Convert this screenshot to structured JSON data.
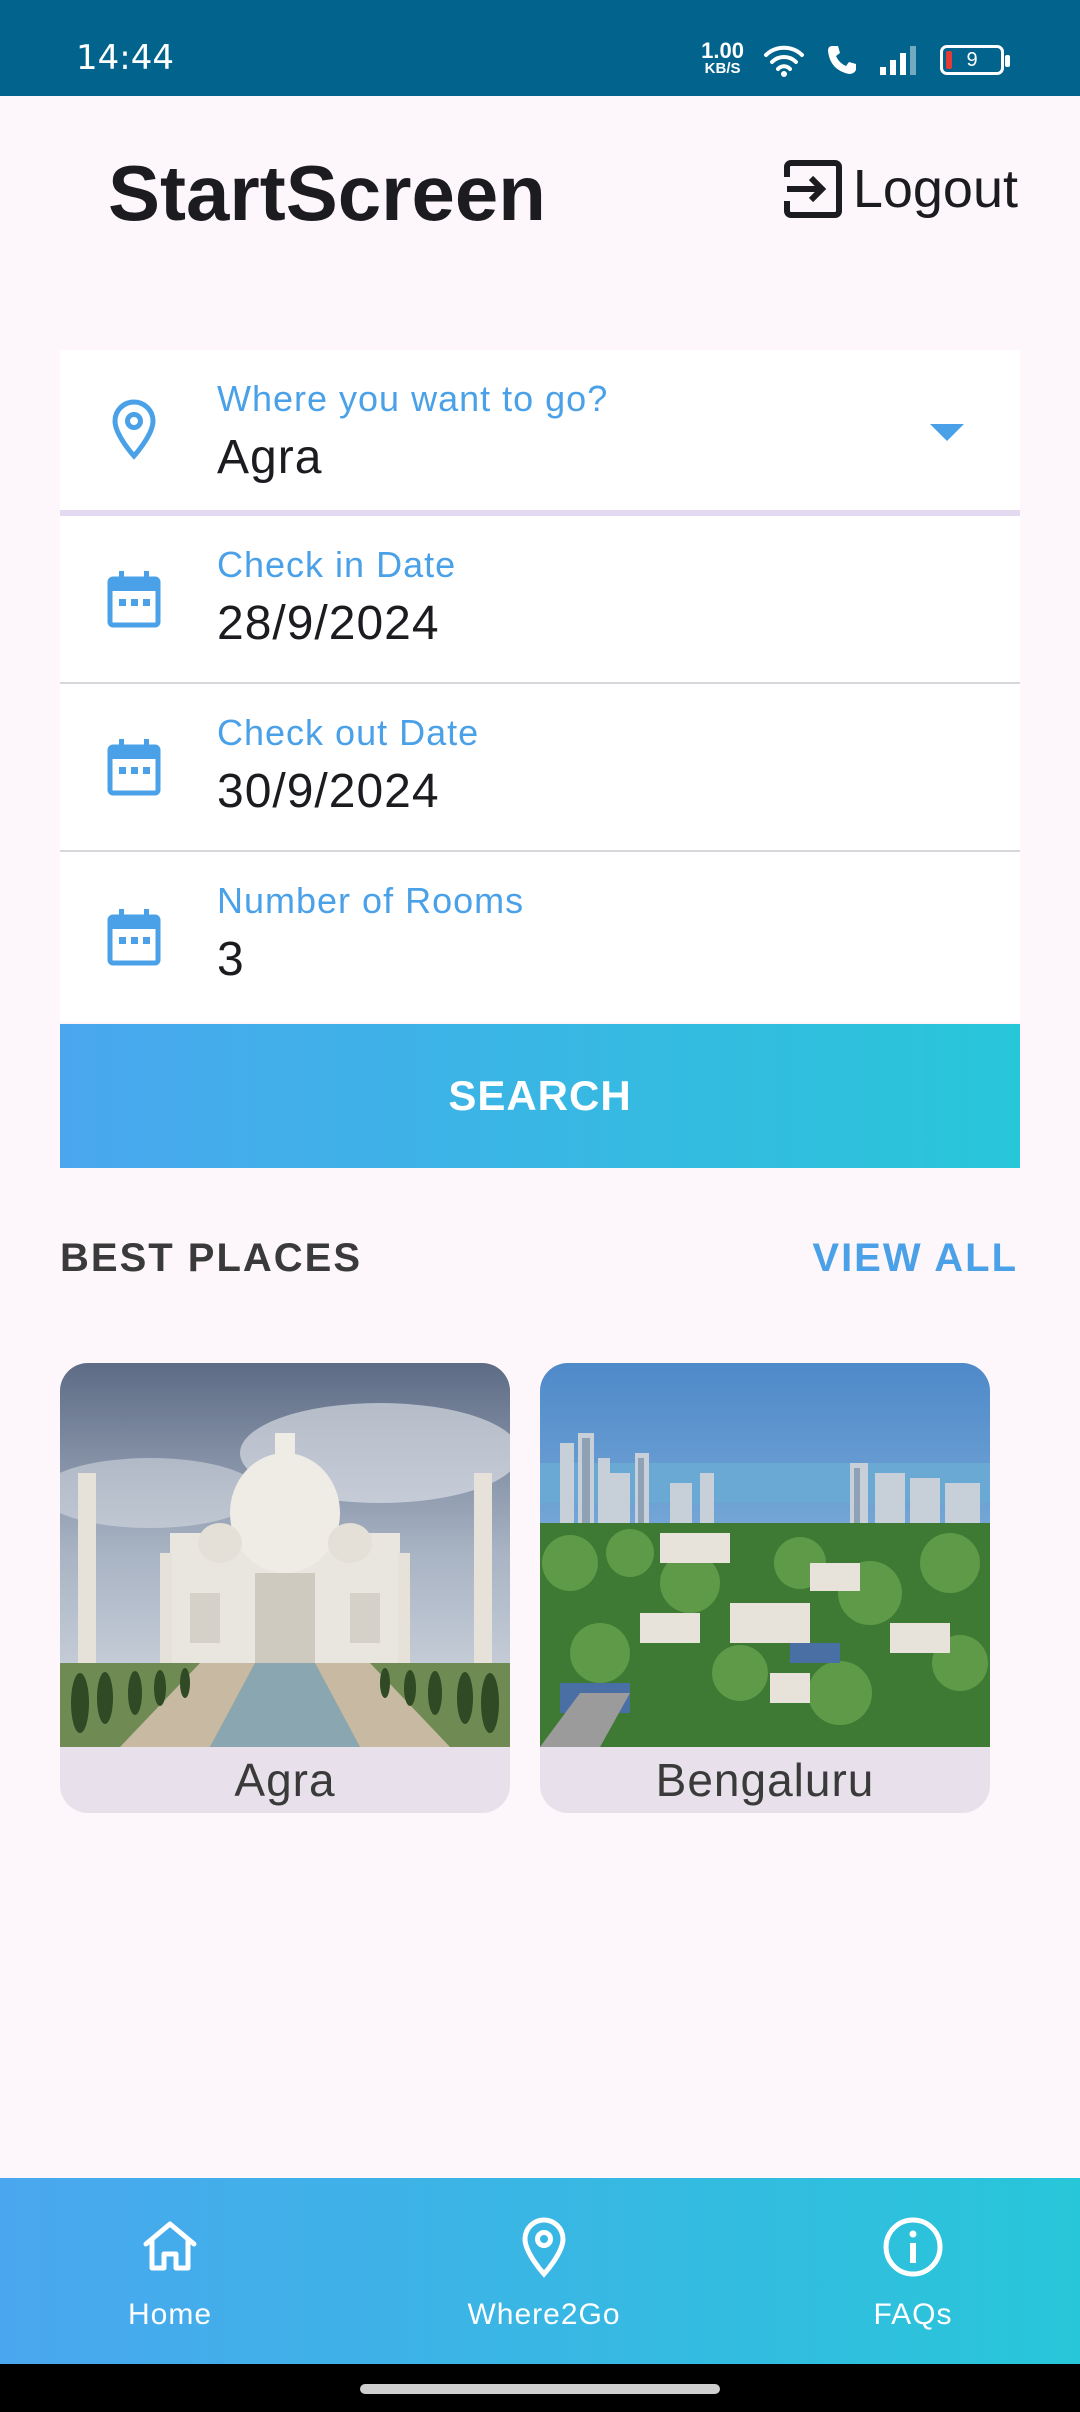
{
  "status_bar": {
    "time": "14:44",
    "net_speed": "1.00",
    "net_unit": "KB/S",
    "battery": "9"
  },
  "header": {
    "title": "StartScreen",
    "logout_label": "Logout",
    "logout_icon": "logout-icon"
  },
  "form": {
    "destination": {
      "label": "Where you want to go?",
      "value": "Agra",
      "icon": "location-pin-icon"
    },
    "check_in": {
      "label": "Check in Date",
      "value": "28/9/2024",
      "icon": "calendar-icon"
    },
    "check_out": {
      "label": "Check out Date",
      "value": "30/9/2024",
      "icon": "calendar-icon"
    },
    "rooms": {
      "label": "Number of Rooms",
      "value": "3",
      "icon": "calendar-icon"
    },
    "search_label": "SEARCH"
  },
  "best_places": {
    "title": "BEST PLACES",
    "view_all": "VIEW ALL",
    "items": [
      {
        "name": "Agra"
      },
      {
        "name": "Bengaluru"
      }
    ]
  },
  "bottom_nav": {
    "items": [
      {
        "label": "Home",
        "icon": "home-icon"
      },
      {
        "label": "Where2Go",
        "icon": "location-pin-icon"
      },
      {
        "label": "FAQs",
        "icon": "info-icon"
      }
    ]
  },
  "colors": {
    "accent": "#4aa1e8",
    "gradient_start": "#4aa7ef",
    "gradient_end": "#28c6d9",
    "status_bar": "#02648c",
    "background": "#fdf7fb"
  }
}
